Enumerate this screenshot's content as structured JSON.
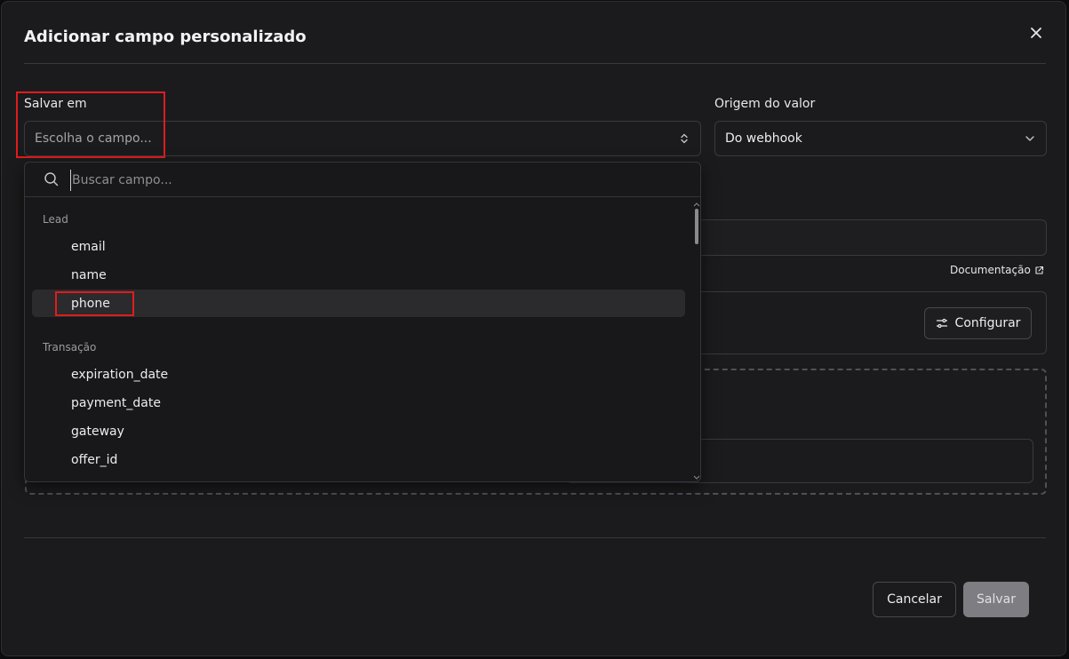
{
  "dialog": {
    "title": "Adicionar campo personalizado",
    "close_icon": "close-icon"
  },
  "save_in": {
    "label": "Salvar em",
    "placeholder": "Escolha o campo..."
  },
  "value_origin": {
    "label": "Origem do valor",
    "value": "Do webhook"
  },
  "dropdown": {
    "search_placeholder": "Buscar campo...",
    "groups": [
      {
        "label": "Lead",
        "options": [
          "email",
          "name",
          "phone"
        ]
      },
      {
        "label": "Transação",
        "options": [
          "expiration_date",
          "payment_date",
          "gateway",
          "offer_id"
        ]
      }
    ],
    "selected": "phone"
  },
  "documentation_link": "Documentação",
  "configure_button": "Configurar",
  "footer": {
    "cancel": "Cancelar",
    "save": "Salvar"
  },
  "colors": {
    "highlight_box": "#e01c1c",
    "save_disabled": "#7e7e82"
  }
}
